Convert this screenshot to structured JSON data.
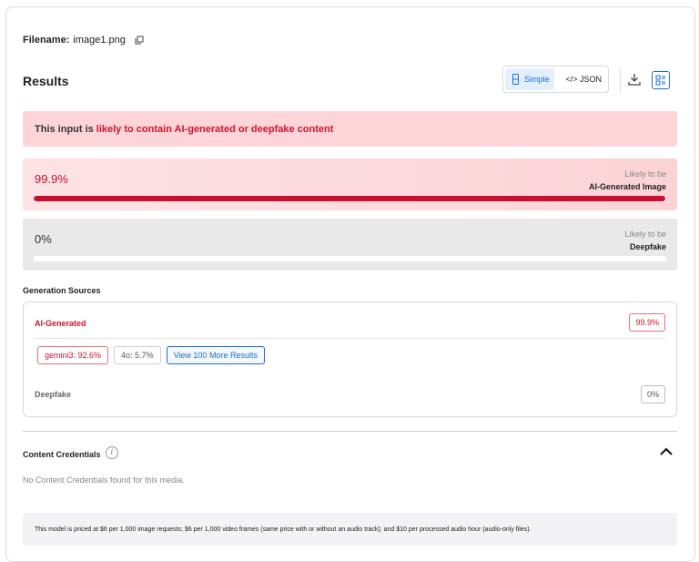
{
  "file": {
    "label": "Filename:",
    "name": "image1.png"
  },
  "results": {
    "title": "Results"
  },
  "view_toggle": {
    "simple": "Simple",
    "json": "</> JSON",
    "selected": "Simple"
  },
  "alert": {
    "prefix": "This input is",
    "highlight": "likely to contain AI-generated or deepfake content"
  },
  "scores": [
    {
      "percent_text": "99.9%",
      "likely": "Likely to be",
      "category": "AI-Generated Image",
      "value": 99.9,
      "color": "#c8102e"
    },
    {
      "percent_text": "0%",
      "likely": "Likely to be",
      "category": "Deepfake",
      "value": 0,
      "color": "#c8102e"
    }
  ],
  "generation_sources": {
    "title": "Generation Sources",
    "ai_label": "AI-Generated",
    "ai_value": "99.9%",
    "chips": [
      "gemini3: 92.6%",
      "4o: 5.7%"
    ],
    "more_button": "View 100 More Results",
    "deepfake_label": "Deepfake",
    "deepfake_value": "0%"
  },
  "content_credentials": {
    "title": "Content Credentials",
    "empty_text": "No Content Credentials found for this media."
  },
  "pricing_note": "This model is priced at $6 per 1,000 image requests; $6 per 1,000 video frames (same price with or without an audio track); and $10 per processed audio hour (audio-only files).",
  "icons": [
    "copy-icon",
    "mobile-icon",
    "download-icon",
    "list-view-icon",
    "info-icon",
    "chevron-up-icon"
  ],
  "colors": {
    "accent": "#1a6de0",
    "danger": "#c8102e",
    "alert_bg": "#fdd5d8"
  }
}
